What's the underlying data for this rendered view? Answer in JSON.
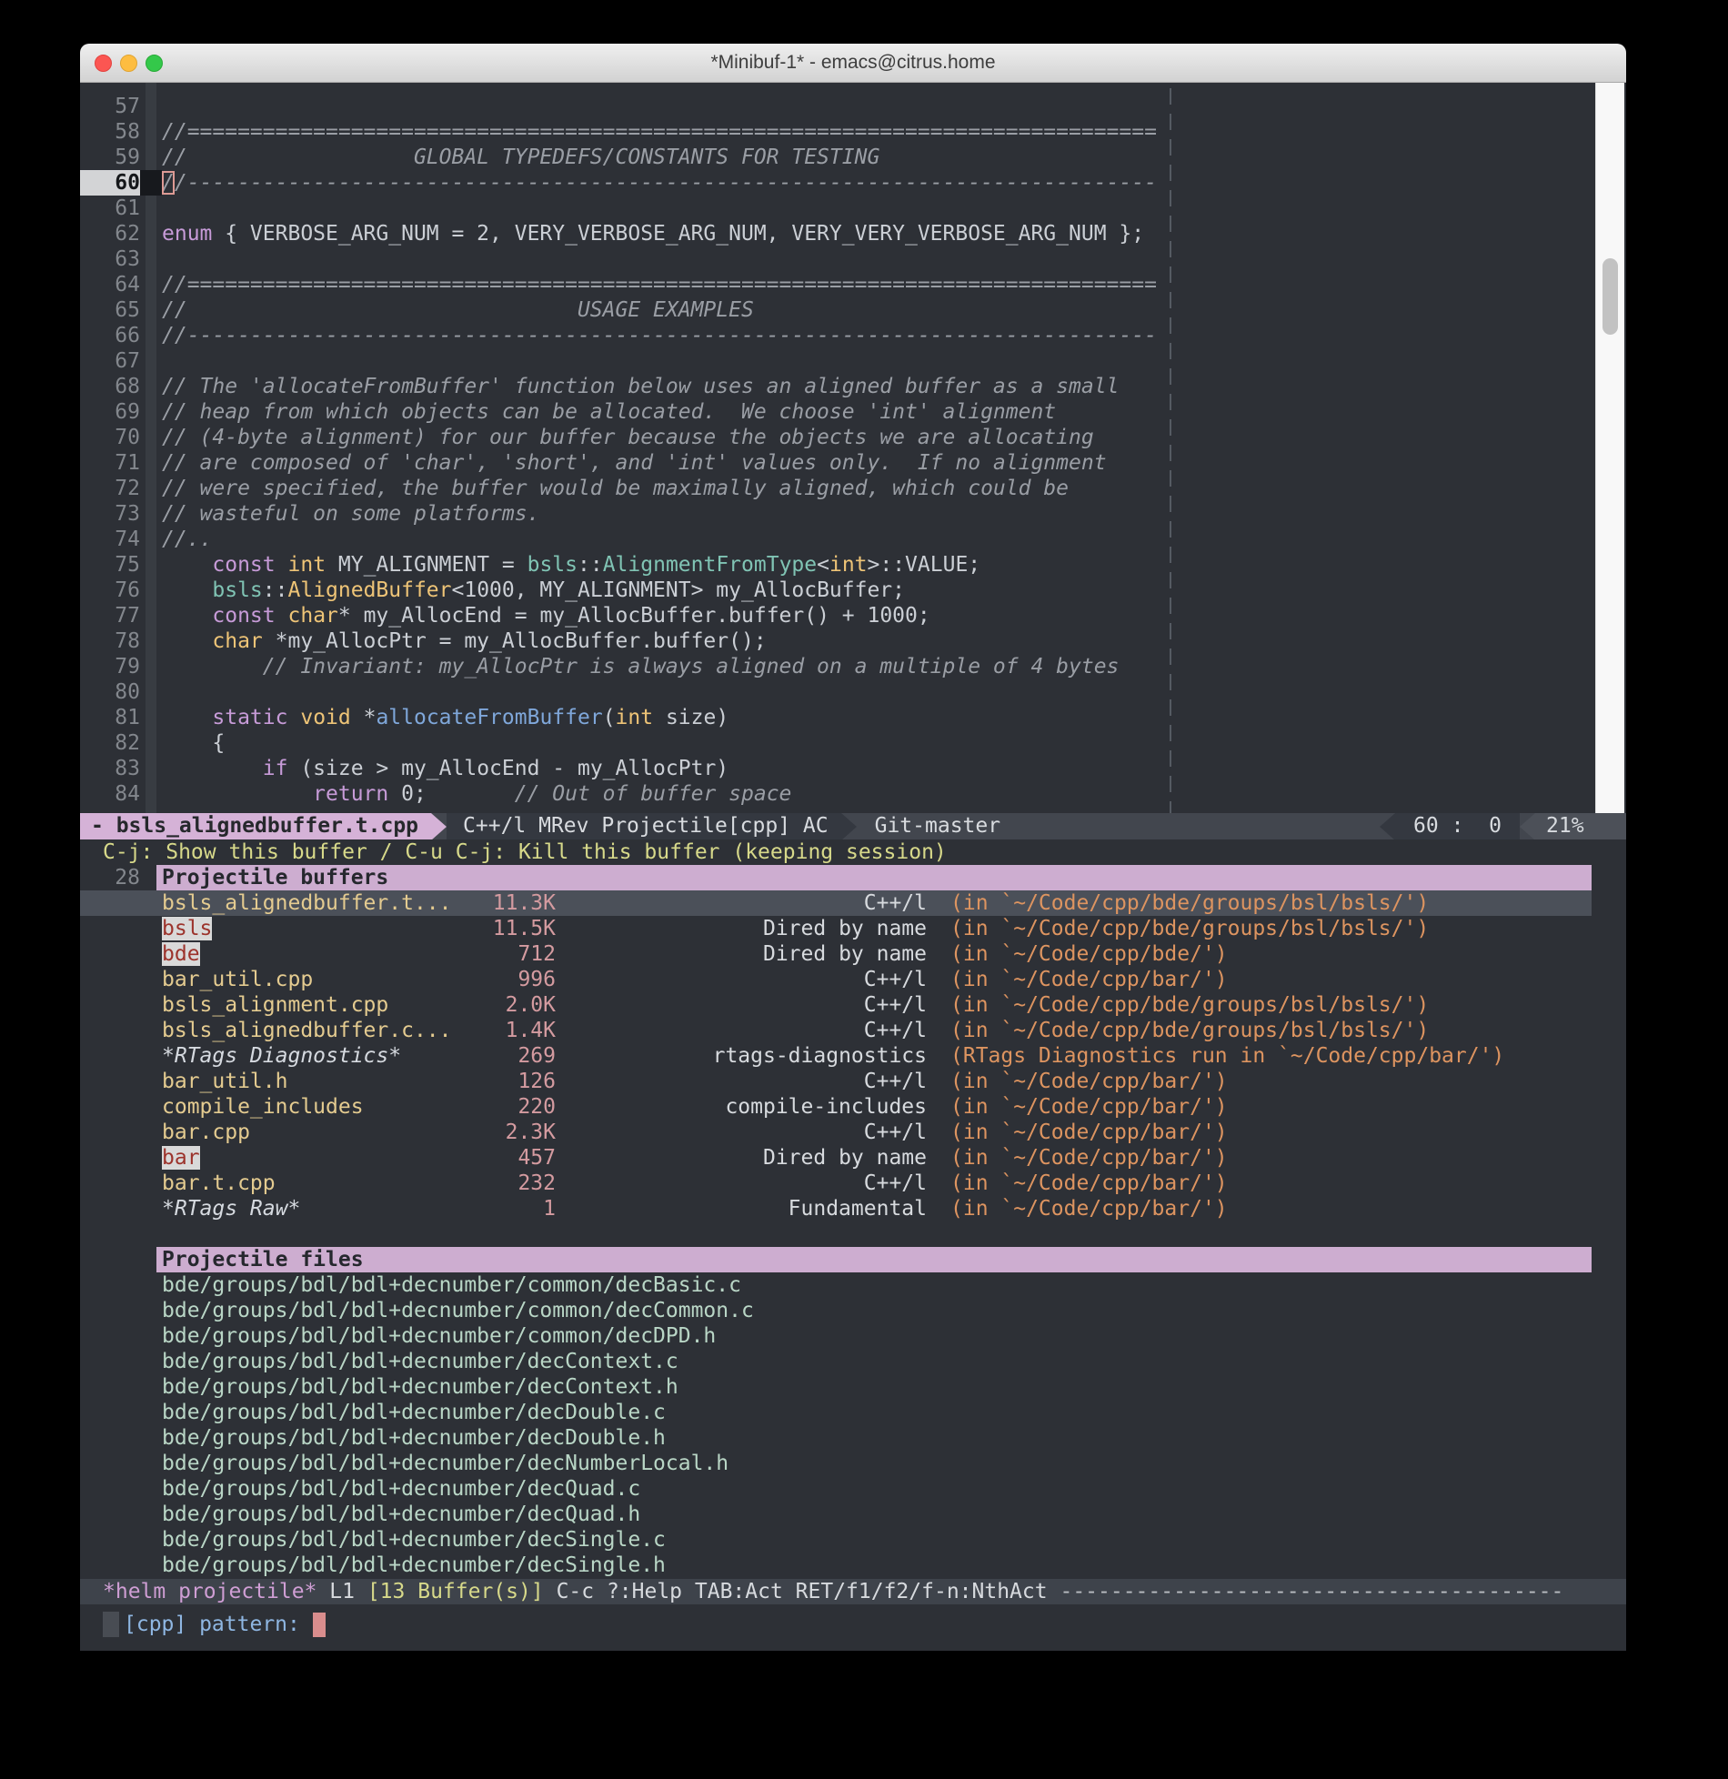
{
  "titlebar": {
    "title": "*Minibuf-1* - emacs@citrus.home"
  },
  "code": {
    "lines": [
      {
        "num": "57",
        "segs": []
      },
      {
        "num": "58",
        "segs": [
          [
            "//=============================================================================",
            "cm"
          ]
        ]
      },
      {
        "num": "59",
        "segs": [
          [
            "//                  GLOBAL TYPEDEFS/CONSTANTS FOR TESTING",
            "cm"
          ]
        ]
      },
      {
        "num": "60",
        "current": true,
        "cursor": true,
        "segs": [
          [
            "//-----------------------------------------------------------------------------",
            "cm"
          ]
        ]
      },
      {
        "num": "61",
        "segs": []
      },
      {
        "num": "62",
        "segs": [
          [
            "enum",
            "kw"
          ],
          [
            " { VERBOSE_ARG_NUM = 2, VERY_VERBOSE_ARG_NUM, VERY_VERY_VERBOSE_ARG_NUM };",
            "df"
          ]
        ]
      },
      {
        "num": "63",
        "segs": []
      },
      {
        "num": "64",
        "segs": [
          [
            "//=============================================================================",
            "cm"
          ]
        ]
      },
      {
        "num": "65",
        "segs": [
          [
            "//                               USAGE EXAMPLES",
            "cm"
          ]
        ]
      },
      {
        "num": "66",
        "segs": [
          [
            "//-----------------------------------------------------------------------------",
            "cm"
          ]
        ]
      },
      {
        "num": "67",
        "segs": []
      },
      {
        "num": "68",
        "segs": [
          [
            "// The 'allocateFromBuffer' function below uses an aligned buffer as a small",
            "cm"
          ]
        ]
      },
      {
        "num": "69",
        "segs": [
          [
            "// heap from which objects can be allocated.  We choose 'int' alignment",
            "cm"
          ]
        ]
      },
      {
        "num": "70",
        "segs": [
          [
            "// (4-byte alignment) for our buffer because the objects we are allocating",
            "cm"
          ]
        ]
      },
      {
        "num": "71",
        "segs": [
          [
            "// are composed of 'char', 'short', and 'int' values only.  If no alignment",
            "cm"
          ]
        ]
      },
      {
        "num": "72",
        "segs": [
          [
            "// were specified, the buffer would be maximally aligned, which could be",
            "cm"
          ]
        ]
      },
      {
        "num": "73",
        "segs": [
          [
            "// wasteful on some platforms.",
            "cm"
          ]
        ]
      },
      {
        "num": "74",
        "segs": [
          [
            "//..",
            "cm"
          ]
        ]
      },
      {
        "num": "75",
        "segs": [
          [
            "    ",
            "df"
          ],
          [
            "const",
            "kw"
          ],
          [
            " ",
            "df"
          ],
          [
            "int",
            "ty"
          ],
          [
            " MY_ALIGNMENT = ",
            "df"
          ],
          [
            "bsls",
            "tl"
          ],
          [
            "::",
            "df"
          ],
          [
            "AlignmentFromType",
            "tl"
          ],
          [
            "<",
            "df"
          ],
          [
            "int",
            "ty"
          ],
          [
            ">::VALUE;",
            "df"
          ]
        ]
      },
      {
        "num": "76",
        "segs": [
          [
            "    ",
            "df"
          ],
          [
            "bsls",
            "tl"
          ],
          [
            "::",
            "df"
          ],
          [
            "AlignedBuffer",
            "ty"
          ],
          [
            "<1000, MY_ALIGNMENT> my_AllocBuffer;",
            "df"
          ]
        ]
      },
      {
        "num": "77",
        "segs": [
          [
            "    ",
            "df"
          ],
          [
            "const",
            "kw"
          ],
          [
            " ",
            "df"
          ],
          [
            "char",
            "ty"
          ],
          [
            "* my_AllocEnd = my_AllocBuffer.buffer() + 1000;",
            "df"
          ]
        ]
      },
      {
        "num": "78",
        "segs": [
          [
            "    ",
            "df"
          ],
          [
            "char",
            "ty"
          ],
          [
            " *my_AllocPtr = my_AllocBuffer.buffer();",
            "df"
          ]
        ]
      },
      {
        "num": "79",
        "segs": [
          [
            "        ",
            "df"
          ],
          [
            "// Invariant: my_AllocPtr is always aligned on a multiple of 4 bytes",
            "cm"
          ]
        ]
      },
      {
        "num": "80",
        "segs": []
      },
      {
        "num": "81",
        "segs": [
          [
            "    ",
            "df"
          ],
          [
            "static",
            "kw"
          ],
          [
            " ",
            "df"
          ],
          [
            "void",
            "ty"
          ],
          [
            " *",
            "df"
          ],
          [
            "allocateFromBuffer",
            "fn"
          ],
          [
            "(",
            "df"
          ],
          [
            "int",
            "ty"
          ],
          [
            " size)",
            "df"
          ]
        ]
      },
      {
        "num": "82",
        "segs": [
          [
            "    {",
            "df"
          ]
        ]
      },
      {
        "num": "83",
        "segs": [
          [
            "        ",
            "df"
          ],
          [
            "if",
            "kw"
          ],
          [
            " (size > my_AllocEnd - my_AllocPtr)",
            "df"
          ]
        ]
      },
      {
        "num": "84",
        "segs": [
          [
            "            ",
            "df"
          ],
          [
            "return",
            "kw"
          ],
          [
            " 0;",
            "df"
          ],
          [
            "       ",
            "df"
          ],
          [
            "// Out of buffer space",
            "cm"
          ]
        ]
      }
    ]
  },
  "modeline": {
    "prefix_file": "- bsls_alignedbuffer.t.cpp",
    "modes": "C++/l MRev Projectile[cpp] AC",
    "branch": "Git-master",
    "line": "60",
    "separator": " :  ",
    "col": "0",
    "percent": "21%"
  },
  "helm": {
    "header_line": "C-j: Show this buffer / C-u C-j: Kill this buffer (keeping session)",
    "rows": [
      {
        "type": "header",
        "gutter": "28",
        "text": "Projectile buffers"
      },
      {
        "type": "buffer",
        "style": "file",
        "selected": true,
        "name": "bsls_alignedbuffer.t...",
        "size": "11.3K",
        "mode": "C++/l",
        "dir": "(in `~/Code/cpp/bde/groups/bsl/bsls/')"
      },
      {
        "type": "buffer",
        "style": "dired",
        "name": "bsls",
        "size": "11.5K",
        "mode": "Dired by name",
        "dir": "(in `~/Code/cpp/bde/groups/bsl/bsls/')"
      },
      {
        "type": "buffer",
        "style": "dired",
        "name": "bde",
        "size": "712",
        "mode": "Dired by name",
        "dir": "(in `~/Code/cpp/bde/')"
      },
      {
        "type": "buffer",
        "style": "file",
        "name": "bar_util.cpp",
        "size": "996",
        "mode": "C++/l",
        "dir": "(in `~/Code/cpp/bar/')"
      },
      {
        "type": "buffer",
        "style": "file",
        "name": "bsls_alignment.cpp",
        "size": "2.0K",
        "mode": "C++/l",
        "dir": "(in `~/Code/cpp/bde/groups/bsl/bsls/')"
      },
      {
        "type": "buffer",
        "style": "file",
        "name": "bsls_alignedbuffer.c...",
        "size": "1.4K",
        "mode": "C++/l",
        "dir": "(in `~/Code/cpp/bde/groups/bsl/bsls/')"
      },
      {
        "type": "buffer",
        "style": "special",
        "name": "*RTags Diagnostics*",
        "size": "269",
        "mode": "rtags-diagnostics",
        "dir": "(RTags Diagnostics run in `~/Code/cpp/bar/')"
      },
      {
        "type": "buffer",
        "style": "file",
        "name": "bar_util.h",
        "size": "126",
        "mode": "C++/l",
        "dir": "(in `~/Code/cpp/bar/')"
      },
      {
        "type": "buffer",
        "style": "file",
        "name": "compile_includes",
        "size": "220",
        "mode": "compile-includes",
        "dir": "(in `~/Code/cpp/bar/')"
      },
      {
        "type": "buffer",
        "style": "file",
        "name": "bar.cpp",
        "size": "2.3K",
        "mode": "C++/l",
        "dir": "(in `~/Code/cpp/bar/')"
      },
      {
        "type": "buffer",
        "style": "dired",
        "name": "bar",
        "size": "457",
        "mode": "Dired by name",
        "dir": "(in `~/Code/cpp/bar/')"
      },
      {
        "type": "buffer",
        "style": "file",
        "name": "bar.t.cpp",
        "size": "232",
        "mode": "C++/l",
        "dir": "(in `~/Code/cpp/bar/')"
      },
      {
        "type": "buffer",
        "style": "special",
        "name": "*RTags Raw*",
        "size": "1",
        "mode": "Fundamental",
        "dir": "(in `~/Code/cpp/bar/')"
      },
      {
        "type": "blank"
      },
      {
        "type": "header",
        "text": "Projectile files"
      },
      {
        "type": "file",
        "path": "bde/groups/bdl/bdl+decnumber/common/decBasic.c"
      },
      {
        "type": "file",
        "path": "bde/groups/bdl/bdl+decnumber/common/decCommon.c"
      },
      {
        "type": "file",
        "path": "bde/groups/bdl/bdl+decnumber/common/decDPD.h"
      },
      {
        "type": "file",
        "path": "bde/groups/bdl/bdl+decnumber/decContext.c"
      },
      {
        "type": "file",
        "path": "bde/groups/bdl/bdl+decnumber/decContext.h"
      },
      {
        "type": "file",
        "path": "bde/groups/bdl/bdl+decnumber/decDouble.c"
      },
      {
        "type": "file",
        "path": "bde/groups/bdl/bdl+decnumber/decDouble.h"
      },
      {
        "type": "file",
        "path": "bde/groups/bdl/bdl+decnumber/decNumberLocal.h"
      },
      {
        "type": "file",
        "path": "bde/groups/bdl/bdl+decnumber/decQuad.c"
      },
      {
        "type": "file",
        "path": "bde/groups/bdl/bdl+decnumber/decQuad.h"
      },
      {
        "type": "file",
        "path": "bde/groups/bdl/bdl+decnumber/decSingle.c"
      },
      {
        "type": "file",
        "path": "bde/groups/bdl/bdl+decnumber/decSingle.h"
      }
    ]
  },
  "helm_modeline": {
    "buffer": "*helm projectile*",
    "line": "L1",
    "count": "[13 Buffer(s)]",
    "help": "C-c ?:Help TAB:Act RET/f1/f2/f-n:NthAct",
    "dashes": "----------------------------------------"
  },
  "minibuffer": {
    "prompt": "[cpp] pattern: "
  }
}
